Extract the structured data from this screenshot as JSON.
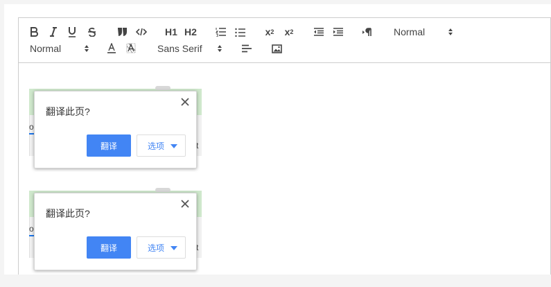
{
  "toolbar": {
    "bold_icon": "bold-icon",
    "italic_icon": "italic-icon",
    "underline_icon": "underline-icon",
    "strike_icon": "strikethrough-icon",
    "quote_icon": "blockquote-icon",
    "code_icon": "code-block-icon",
    "h1_label": "H1",
    "h2_label": "H2",
    "subscript_label": "x",
    "superscript_label": "x",
    "header_select": "Normal",
    "size_select": "Normal",
    "font_select": "Sans Serif"
  },
  "snippets": [
    {
      "left_fragment": "o",
      "right_fragment": "t",
      "dialog": {
        "title": "翻译此页?",
        "translate_label": "翻译",
        "options_label": "选项"
      }
    },
    {
      "left_fragment": "o",
      "right_fragment": "t",
      "dialog": {
        "title": "翻译此页?",
        "translate_label": "翻译",
        "options_label": "选项"
      }
    }
  ],
  "colors": {
    "primary": "#4285f4",
    "green_bar": "#cfe8cc",
    "toolbar_icon": "#444444"
  }
}
